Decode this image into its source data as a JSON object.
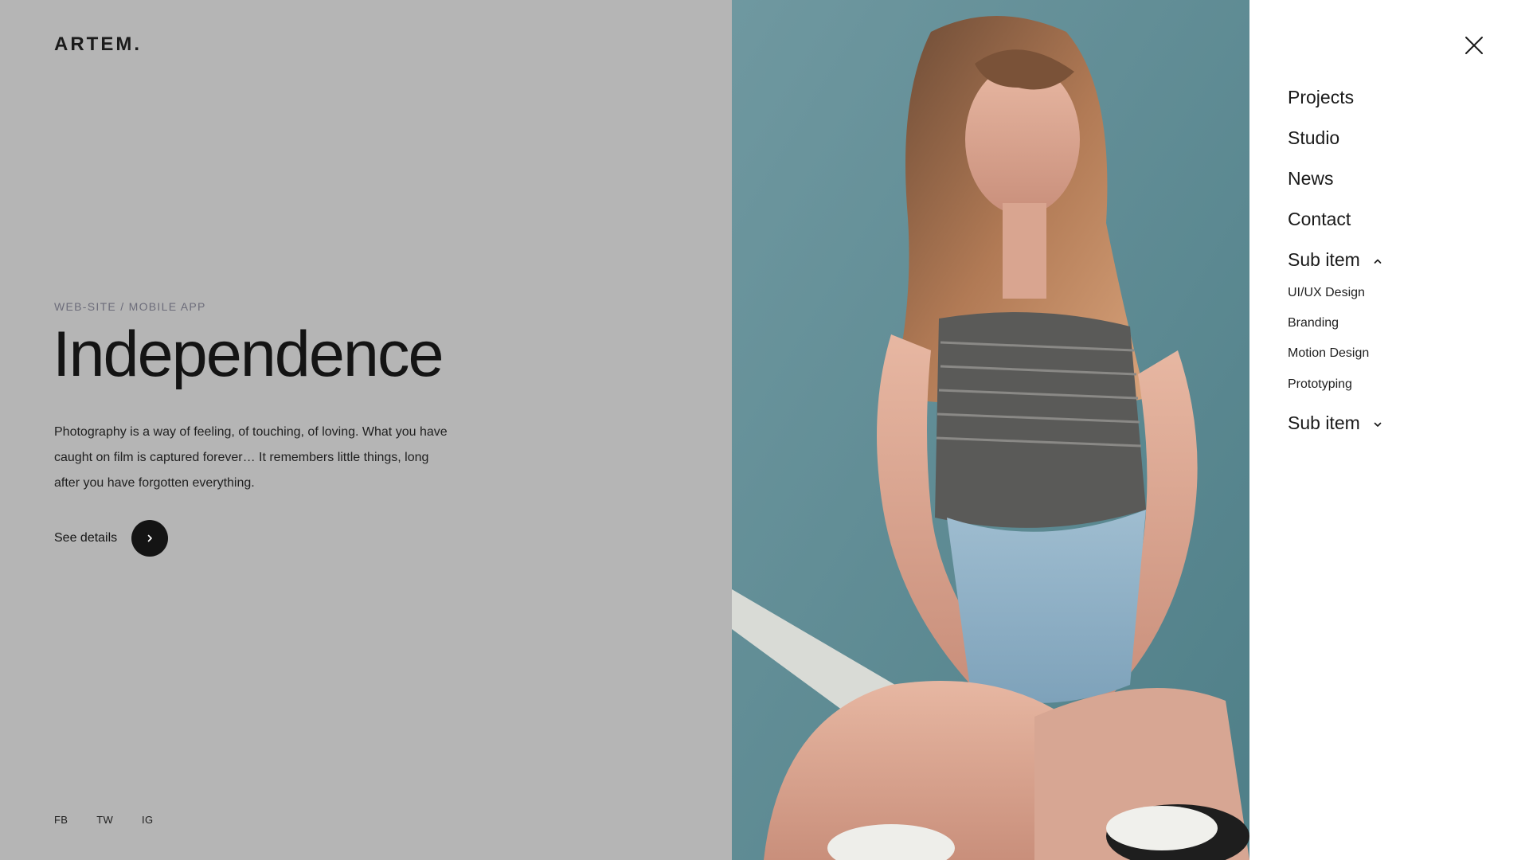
{
  "brand": {
    "logo_text": "ARTEM."
  },
  "hero": {
    "eyebrow": "WEB-SITE / MOBILE APP",
    "title": "Independence",
    "description": "Photography is a way of feeling, of touching, of loving. What you have caught on film is captured forever… It remembers little things, long after you have forgotten everything.",
    "cta_label": "See details",
    "cta_icon": "chevron-right-icon"
  },
  "social": [
    "FB",
    "TW",
    "IG"
  ],
  "menu": {
    "close_icon": "close-icon",
    "items": [
      {
        "label": "Projects"
      },
      {
        "label": "Studio"
      },
      {
        "label": "News"
      },
      {
        "label": "Contact"
      }
    ],
    "sub_groups": [
      {
        "label": "Sub item",
        "expanded": true,
        "icon": "chevron-up-icon",
        "children": [
          "UI/UX Design",
          "Branding",
          "Motion Design",
          "Prototyping"
        ]
      },
      {
        "label": "Sub item",
        "expanded": false,
        "icon": "chevron-down-icon",
        "children": []
      }
    ]
  },
  "colors": {
    "overlay_gray": "#b5b5b5",
    "text_dark": "#141414",
    "eyebrow_gray": "#6c6c7a",
    "photo_teal": "#5e8b93",
    "menu_bg": "#ffffff"
  }
}
